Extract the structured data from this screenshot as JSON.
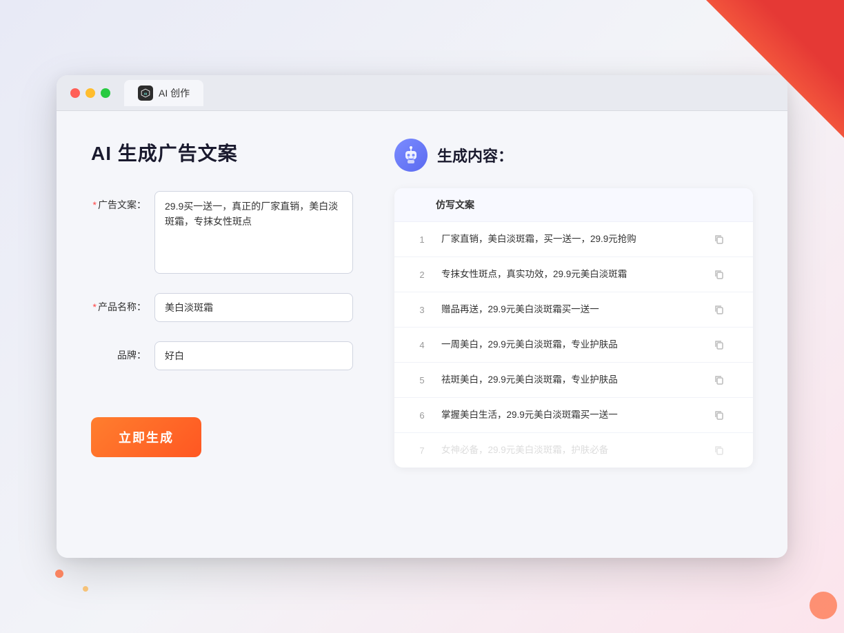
{
  "window": {
    "tab_label": "AI 创作"
  },
  "left_panel": {
    "title": "AI 生成广告文案",
    "fields": [
      {
        "label": "广告文案：",
        "required": true,
        "type": "textarea",
        "value": "29.9买一送一，真正的厂家直销，美白淡斑霜，专抹女性斑点",
        "name": "ad-copy-field"
      },
      {
        "label": "产品名称：",
        "required": true,
        "type": "input",
        "value": "美白淡斑霜",
        "name": "product-name-field"
      },
      {
        "label": "品牌：",
        "required": false,
        "type": "input",
        "value": "好白",
        "name": "brand-field"
      }
    ],
    "button_label": "立即生成"
  },
  "right_panel": {
    "title": "生成内容：",
    "table_header": "仿写文案",
    "results": [
      {
        "num": "1",
        "text": "厂家直销，美白淡斑霜，买一送一，29.9元抢购",
        "faded": false
      },
      {
        "num": "2",
        "text": "专抹女性斑点，真实功效，29.9元美白淡斑霜",
        "faded": false
      },
      {
        "num": "3",
        "text": "赠品再送，29.9元美白淡斑霜买一送一",
        "faded": false
      },
      {
        "num": "4",
        "text": "一周美白，29.9元美白淡斑霜，专业护肤品",
        "faded": false
      },
      {
        "num": "5",
        "text": "祛斑美白，29.9元美白淡斑霜，专业护肤品",
        "faded": false
      },
      {
        "num": "6",
        "text": "掌握美白生活，29.9元美白淡斑霜买一送一",
        "faded": false
      },
      {
        "num": "7",
        "text": "女神必备，29.9元美白淡斑霜，护肤必备",
        "faded": true
      }
    ]
  },
  "traffic_lights": {
    "red": "#ff5f57",
    "yellow": "#ffbd2e",
    "green": "#28ca41"
  }
}
